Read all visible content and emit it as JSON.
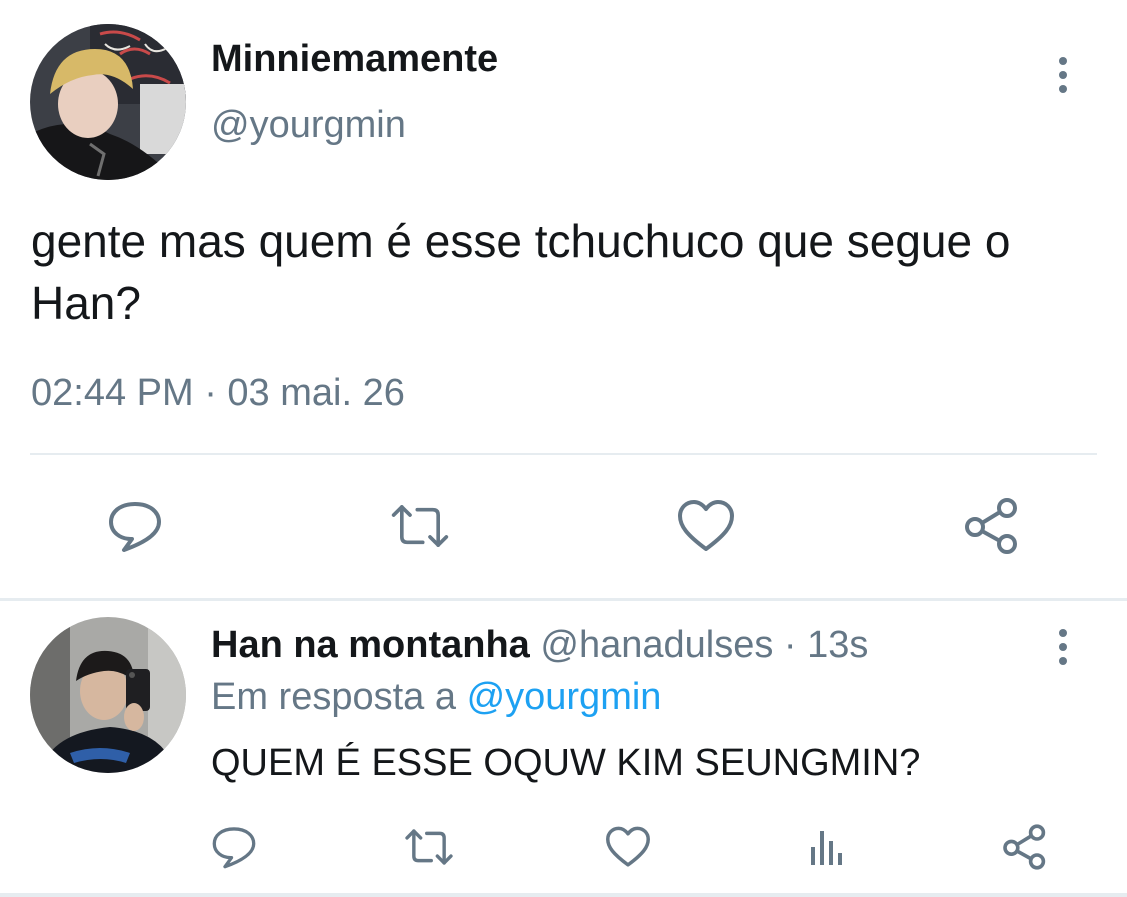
{
  "main_tweet": {
    "display_name": "Minniemamente",
    "handle": "@yourgmin",
    "text": "gente mas quem é esse tchuchuco que segue o Han?",
    "timestamp": "02:44 PM · 03 mai. 26",
    "icons": [
      "more-vertical-icon",
      "reply-icon",
      "retweet-icon",
      "like-icon",
      "share-icon"
    ]
  },
  "reply_tweet": {
    "display_name": "Han na montanha",
    "handle_time": " @hanadulses · 13s",
    "reply_prefix": "Em resposta a ",
    "reply_to": "@yourgmin",
    "text": "QUEM É ESSE OQUW KIM SEUNGMIN?",
    "icons": [
      "more-vertical-icon",
      "reply-icon",
      "retweet-icon",
      "like-icon",
      "stats-icon",
      "share-icon"
    ]
  },
  "colors": {
    "text_primary": "#14171a",
    "text_secondary": "#657786",
    "link": "#1da1f2",
    "divider": "#e6ecf0"
  }
}
